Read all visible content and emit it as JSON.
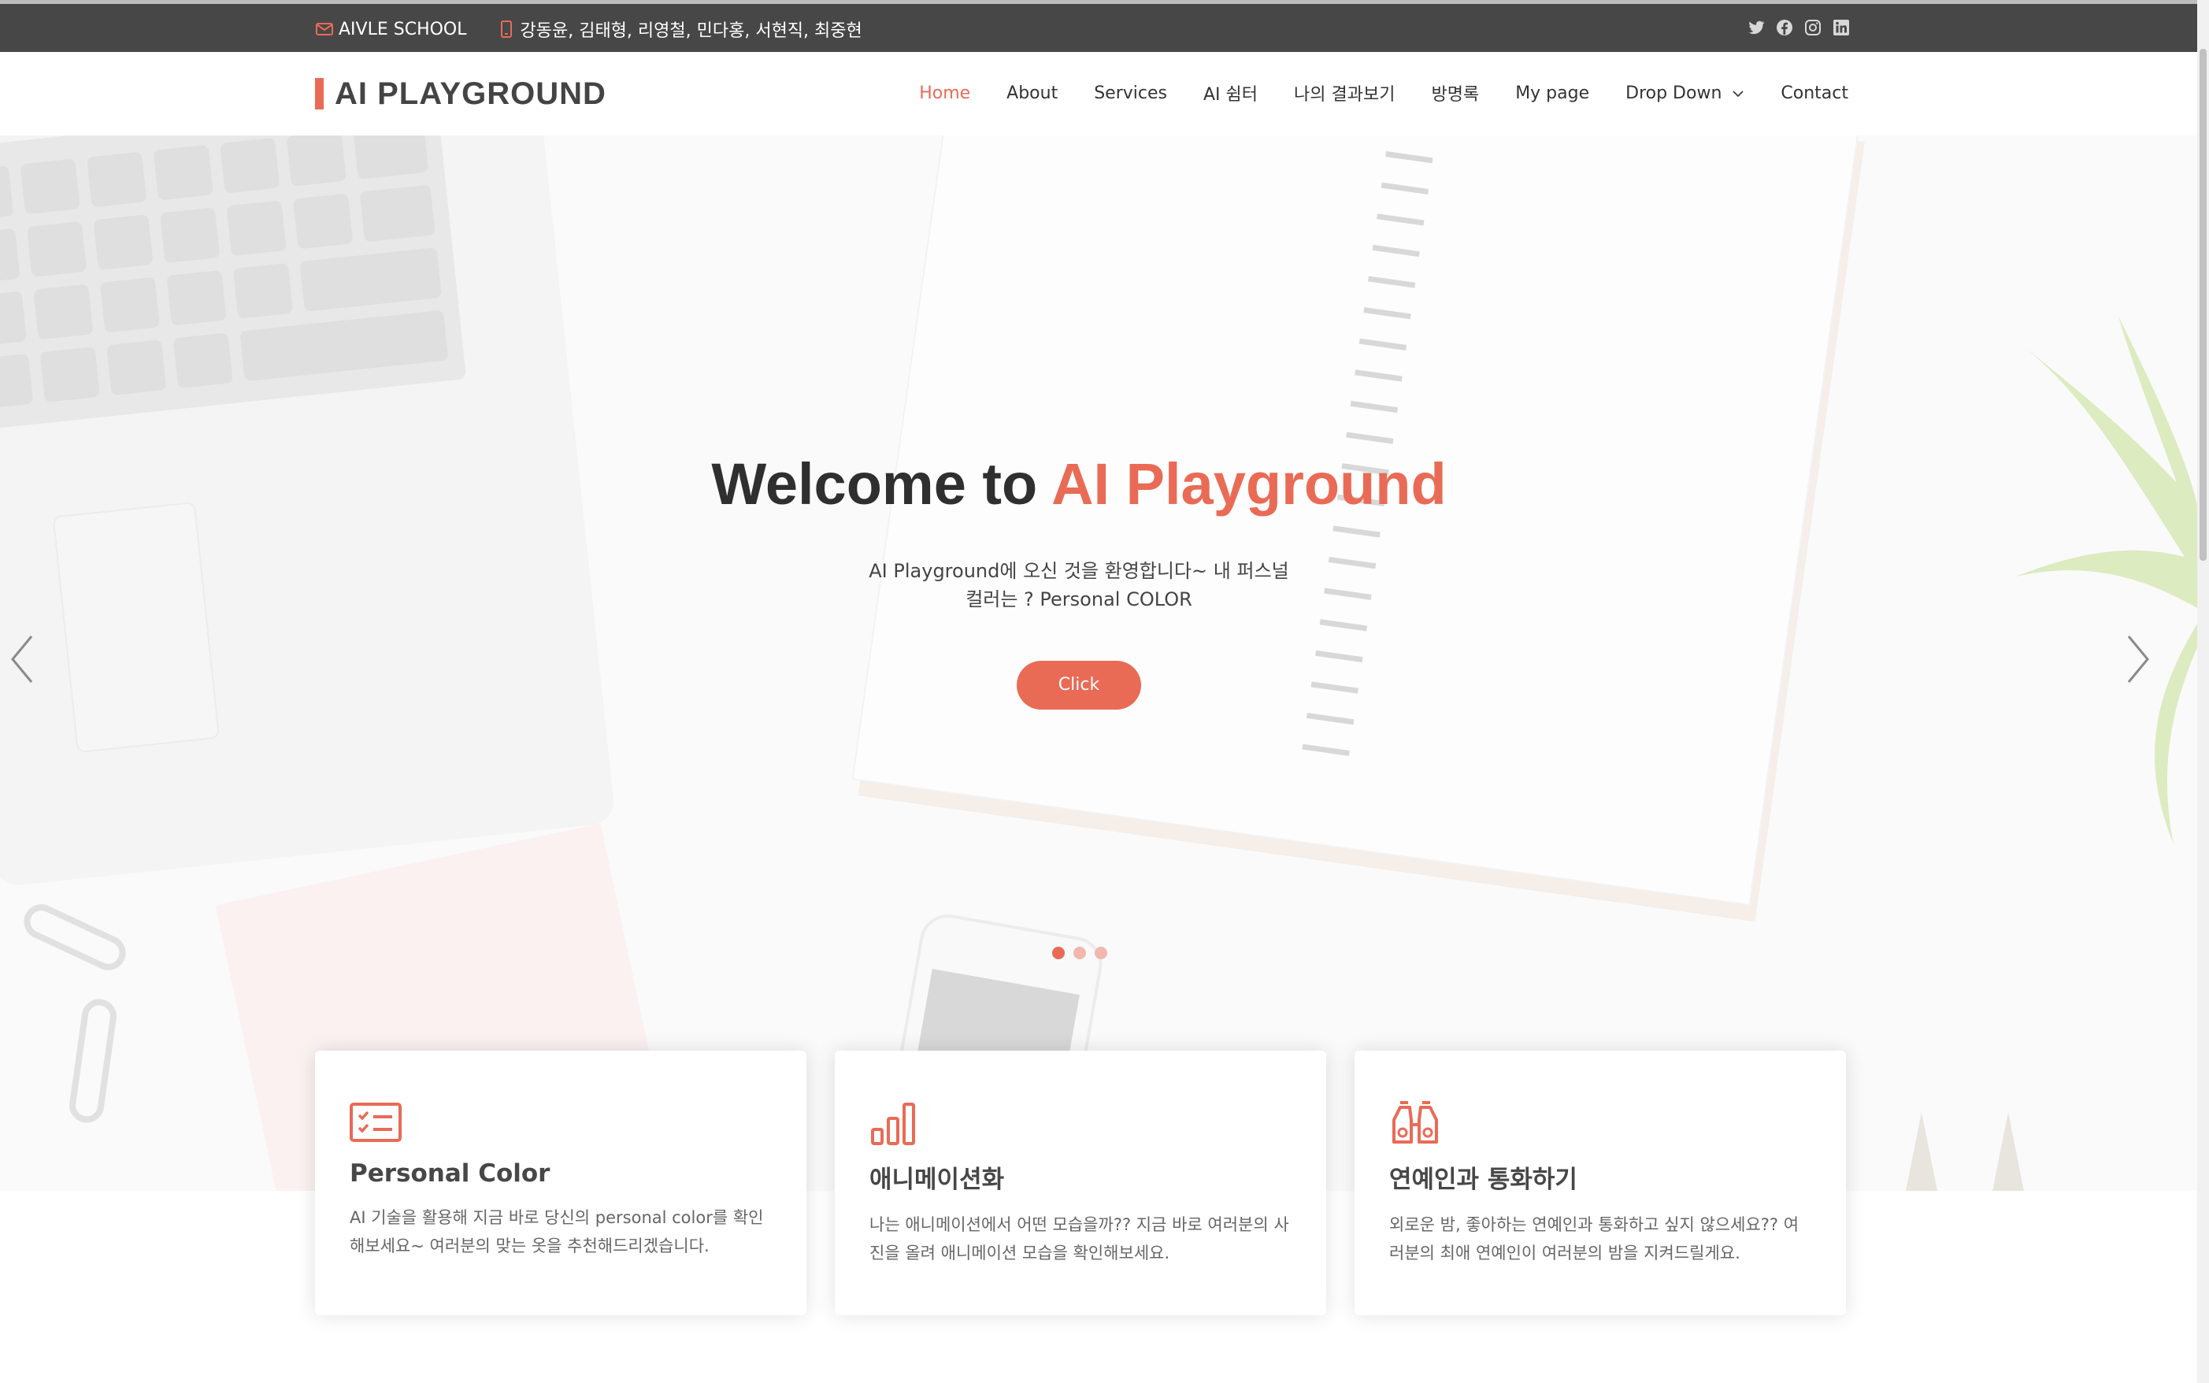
{
  "topbar": {
    "school": "AIVLE SCHOOL",
    "members": "강동윤, 김태형, 리영철, 민다홍, 서현직, 최중현",
    "icons": [
      "envelope-icon",
      "phone-icon"
    ],
    "social": [
      "twitter-icon",
      "facebook-icon",
      "instagram-icon",
      "linkedin-icon"
    ]
  },
  "header": {
    "logo": "AI PLAYGROUND",
    "nav": [
      {
        "label": "Home",
        "active": true
      },
      {
        "label": "About"
      },
      {
        "label": "Services"
      },
      {
        "label": "AI 쉼터"
      },
      {
        "label": "나의 결과보기"
      },
      {
        "label": "방명록"
      },
      {
        "label": "My page"
      },
      {
        "label": "Drop Down"
      },
      {
        "label": "Contact"
      }
    ]
  },
  "hero": {
    "title_plain": "Welcome to",
    "title_accent": "AI Playground",
    "description": "AI Playground에 오신 것을 환영합니다~ 내 퍼스널 컬러는 ? Personal COLOR",
    "button": "Click",
    "slides": 3,
    "active_slide": 1
  },
  "cards": [
    {
      "icon": "list-check-icon",
      "title": "Personal Color",
      "description": "AI 기술을 활용해 지금 바로 당신의 personal color를 확인해보세요~ 여러분의 맞는 옷을 추천해드리겠습니다."
    },
    {
      "icon": "bar-chart-icon",
      "title": "애니메이션화",
      "description": "나는 애니메이션에서 어떤 모습을까?? 지금 바로 여러분의 사진을 올려 애니메이션 모습을 확인해보세요."
    },
    {
      "icon": "binoculars-icon",
      "title": "연예인과 통화하기",
      "description": "외로운 밤, 좋아하는 연예인과 통화하고 싶지 않으세요?? 여러분의 최애 연예인이 여러분의 밤을 지켜드릴게요."
    }
  ],
  "colors": {
    "accent": "#e96b56",
    "topbar_bg": "#474747",
    "text_dark": "#2f2f2f"
  }
}
